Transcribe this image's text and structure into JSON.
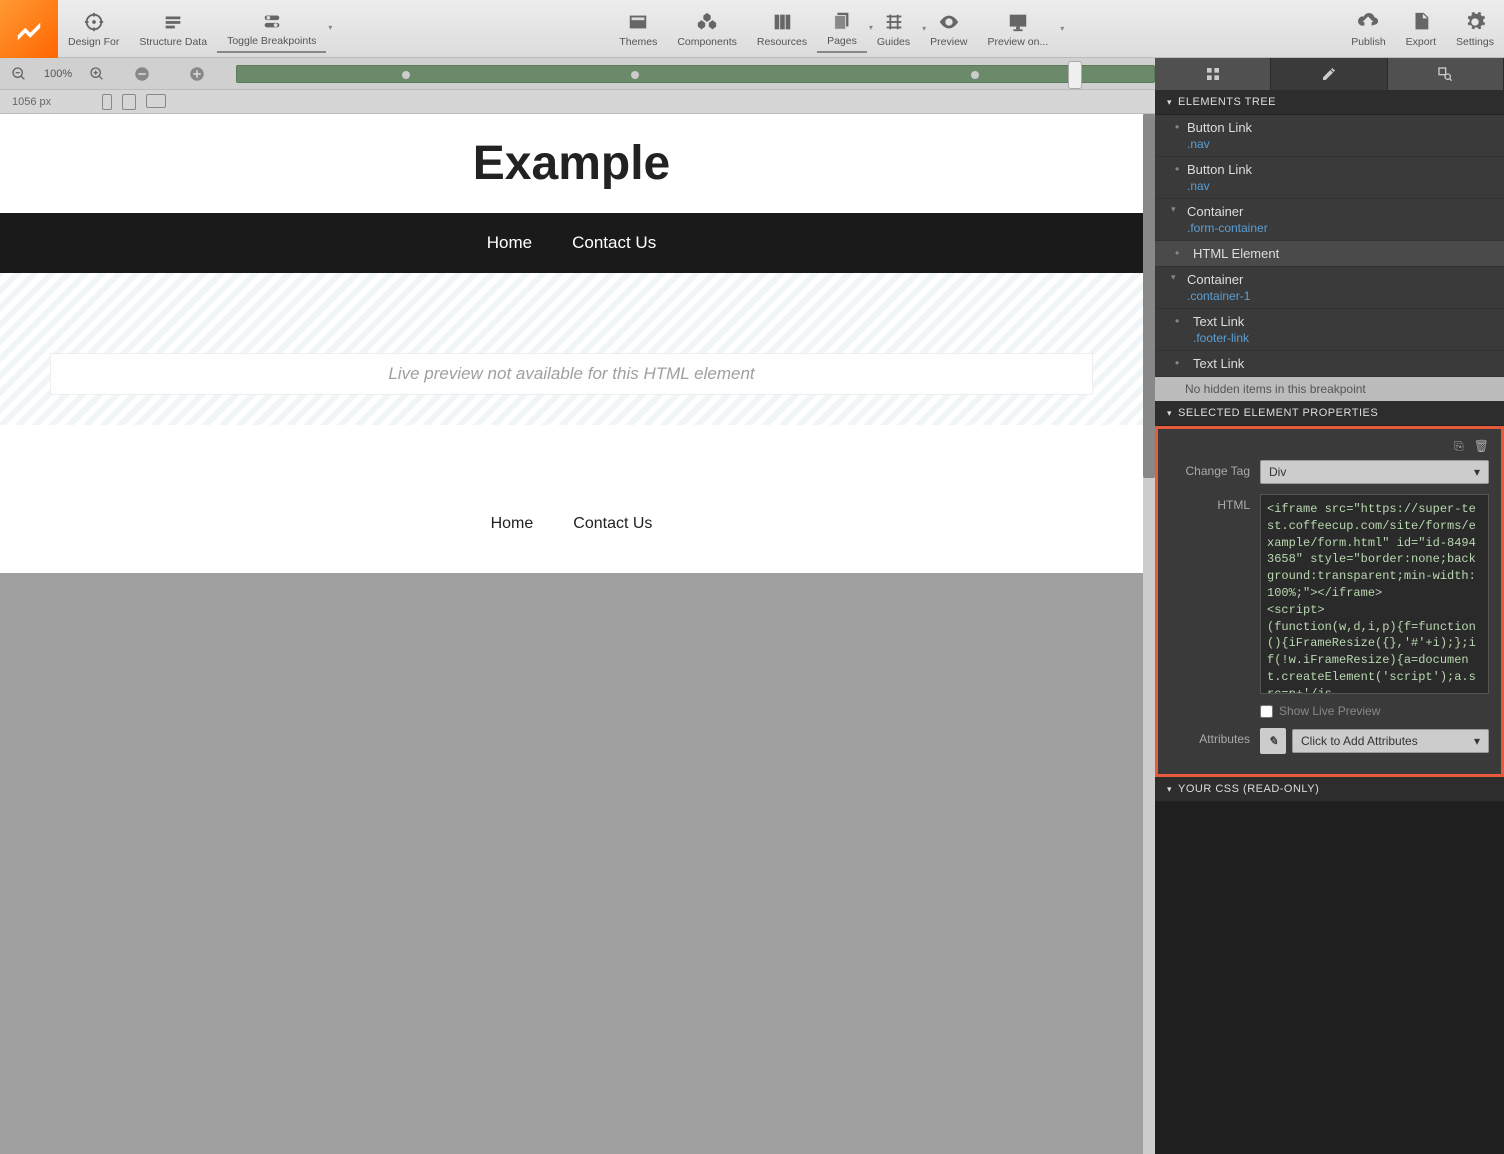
{
  "toolbar": {
    "left": [
      {
        "label": "Design For",
        "icon": "target"
      },
      {
        "label": "Structure Data",
        "icon": "structure"
      },
      {
        "label": "Toggle Breakpoints",
        "icon": "toggle",
        "active": true,
        "dropdown": true
      }
    ],
    "center": [
      {
        "label": "Themes",
        "icon": "themes"
      },
      {
        "label": "Components",
        "icon": "components"
      },
      {
        "label": "Resources",
        "icon": "resources"
      },
      {
        "label": "Pages",
        "icon": "pages",
        "active": true,
        "dropdown": true
      },
      {
        "label": "Guides",
        "icon": "guides",
        "dropdown": true
      },
      {
        "label": "Preview",
        "icon": "preview"
      },
      {
        "label": "Preview on...",
        "icon": "preview-on",
        "dropdown": true
      }
    ],
    "right": [
      {
        "label": "Publish",
        "icon": "publish"
      },
      {
        "label": "Export",
        "icon": "export"
      },
      {
        "label": "Settings",
        "icon": "settings"
      }
    ]
  },
  "zoom": {
    "value": "100%"
  },
  "width_indicator": "1056 px",
  "preview": {
    "title": "Example",
    "nav": [
      "Home",
      "Contact Us"
    ],
    "placeholder": "Live preview not available for this HTML element",
    "footer_links": [
      "Home",
      "Contact Us"
    ]
  },
  "panels": {
    "tree_header": "ELEMENTS TREE",
    "tree_items": [
      {
        "label": "Button Link",
        "class": ".nav",
        "indent": 1
      },
      {
        "label": "Button Link",
        "class": ".nav",
        "indent": 1
      },
      {
        "label": "Container",
        "class": ".form-container",
        "indent": 1,
        "expandable": true
      },
      {
        "label": "HTML Element",
        "indent": 2,
        "selected": true
      },
      {
        "label": "Container",
        "class": ".container-1",
        "indent": 1,
        "expandable": true
      },
      {
        "label": "Text Link",
        "class": ".footer-link",
        "indent": 2
      },
      {
        "label": "Text Link",
        "indent": 2
      }
    ],
    "hidden_items": "No hidden items in this breakpoint",
    "props_header": "SELECTED ELEMENT PROPERTIES",
    "change_tag_label": "Change Tag",
    "change_tag_value": "Div",
    "html_label": "HTML",
    "html_content": "<iframe src=\"https://super-test.coffeecup.com/site/forms/example/form.html\" id=\"id-84943658\" style=\"border:none;background:transparent;min-width:100%;\"></iframe>\n<script>\n(function(w,d,i,p){f=function(){iFrameResize({},'#'+i);};if(!w.iFrameResize){a=document.createElement('script');a.src=p+'/js",
    "show_preview_label": "Show Live Preview",
    "attributes_label": "Attributes",
    "attributes_placeholder": "Click to Add Attributes",
    "css_header": "YOUR CSS (READ-ONLY)"
  }
}
